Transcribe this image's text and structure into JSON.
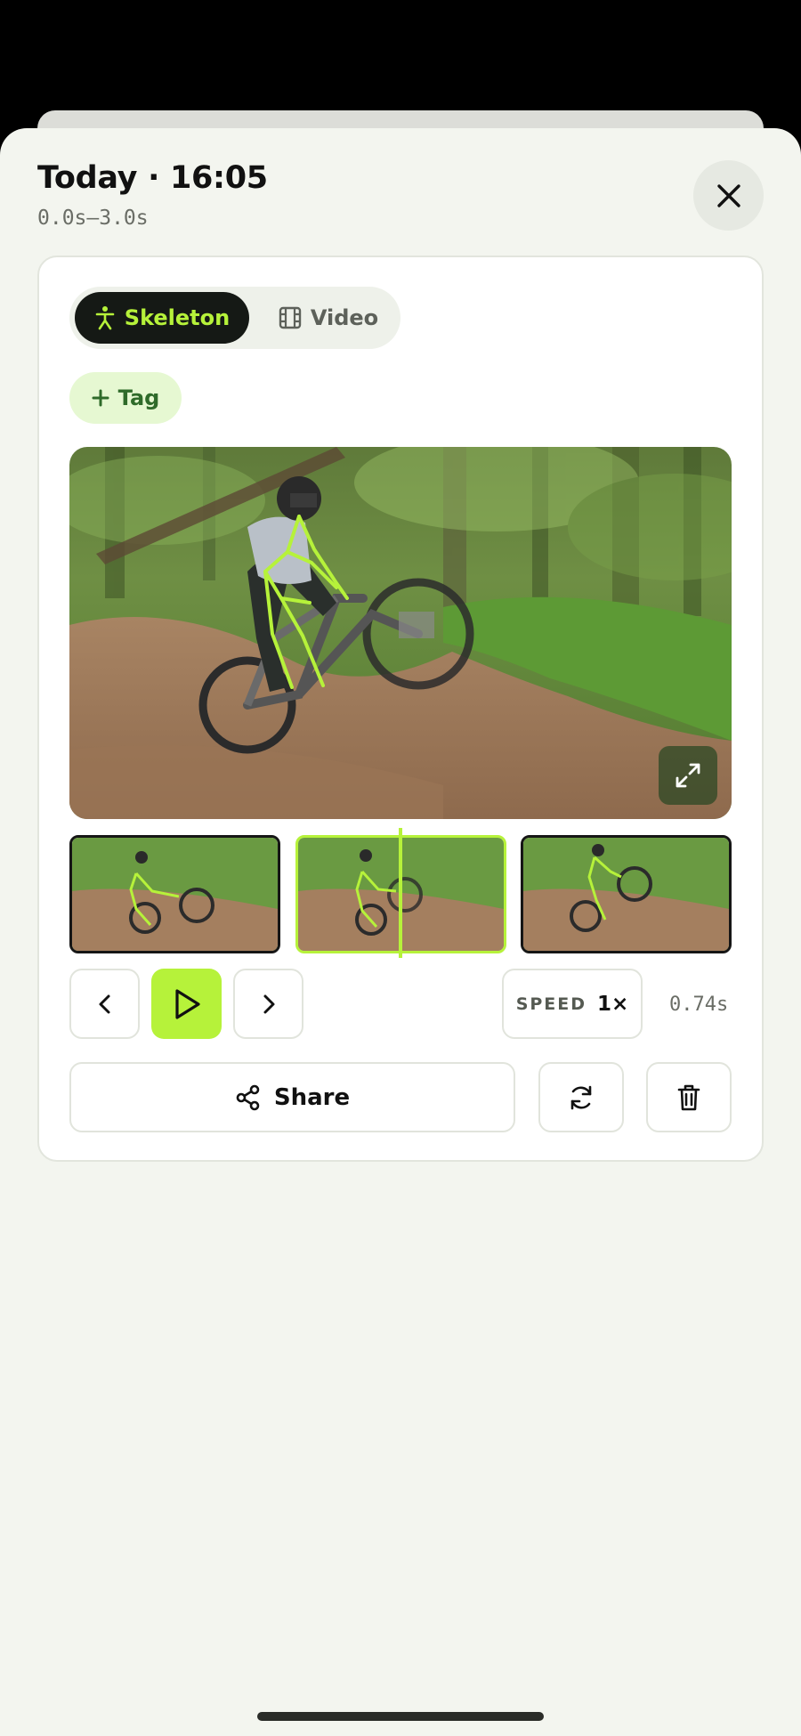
{
  "header": {
    "title": "Today · 16:05",
    "range": "0.0s–3.0s"
  },
  "view_toggle": {
    "options": [
      {
        "label": "Skeleton",
        "icon": "person-icon",
        "selected": true
      },
      {
        "label": "Video",
        "icon": "film-icon",
        "selected": false
      }
    ]
  },
  "tag_button": {
    "label": "Tag",
    "icon": "plus-icon"
  },
  "controls": {
    "speed_label": "SPEED",
    "speed_value": "1×",
    "time": "0.74s"
  },
  "actions": {
    "share_label": "Share"
  },
  "colors": {
    "accent": "#b6f23a",
    "dark": "#151915",
    "background": "#f3f5ef"
  }
}
